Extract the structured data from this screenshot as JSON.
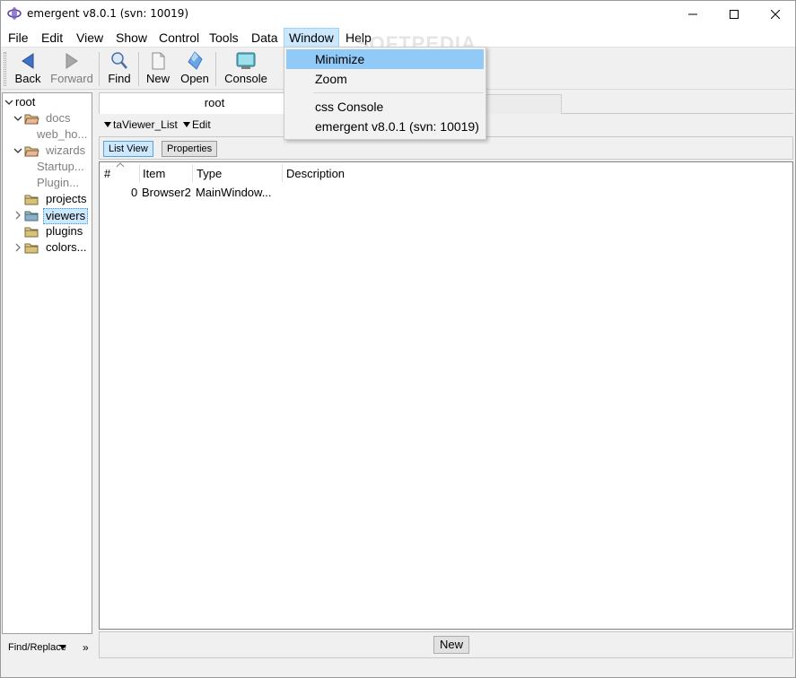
{
  "window": {
    "title": "emergent v8.0.1 (svn: 10019)"
  },
  "menubar": {
    "items": [
      "File",
      "Edit",
      "View",
      "Show",
      "Control",
      "Tools",
      "Data",
      "Window",
      "Help"
    ]
  },
  "toolbar": {
    "back": "Back",
    "forward": "Forward",
    "find": "Find",
    "new": "New",
    "open": "Open",
    "console": "Console"
  },
  "tree": {
    "items": [
      {
        "label": "root"
      },
      {
        "label": "docs"
      },
      {
        "label": "web_ho..."
      },
      {
        "label": "wizards"
      },
      {
        "label": "Startup..."
      },
      {
        "label": "Plugin..."
      },
      {
        "label": "projects"
      },
      {
        "label": "viewers"
      },
      {
        "label": "plugins"
      },
      {
        "label": "colors..."
      }
    ]
  },
  "findreplace": {
    "label": "Find/Replace",
    "more": "»"
  },
  "main": {
    "tab_root": "root",
    "sub_viewer": "taViewer_List",
    "sub_edit": "Edit",
    "view_tabs": [
      "List View",
      "Properties"
    ],
    "columns": [
      "#",
      "Item",
      "Type",
      "Description"
    ],
    "rows": [
      {
        "num": "0",
        "item": "Browser2",
        "type": "MainWindow...",
        "desc": ""
      }
    ],
    "new_button": "New"
  },
  "window_menu": {
    "items": [
      "Minimize",
      "Zoom",
      "css Console",
      "emergent v8.0.1 (svn: 10019)"
    ]
  },
  "watermark": "SOFTPEDIA",
  "colors": {
    "selection": "#cce8ff",
    "menu_highlight": "#91c9f7"
  }
}
